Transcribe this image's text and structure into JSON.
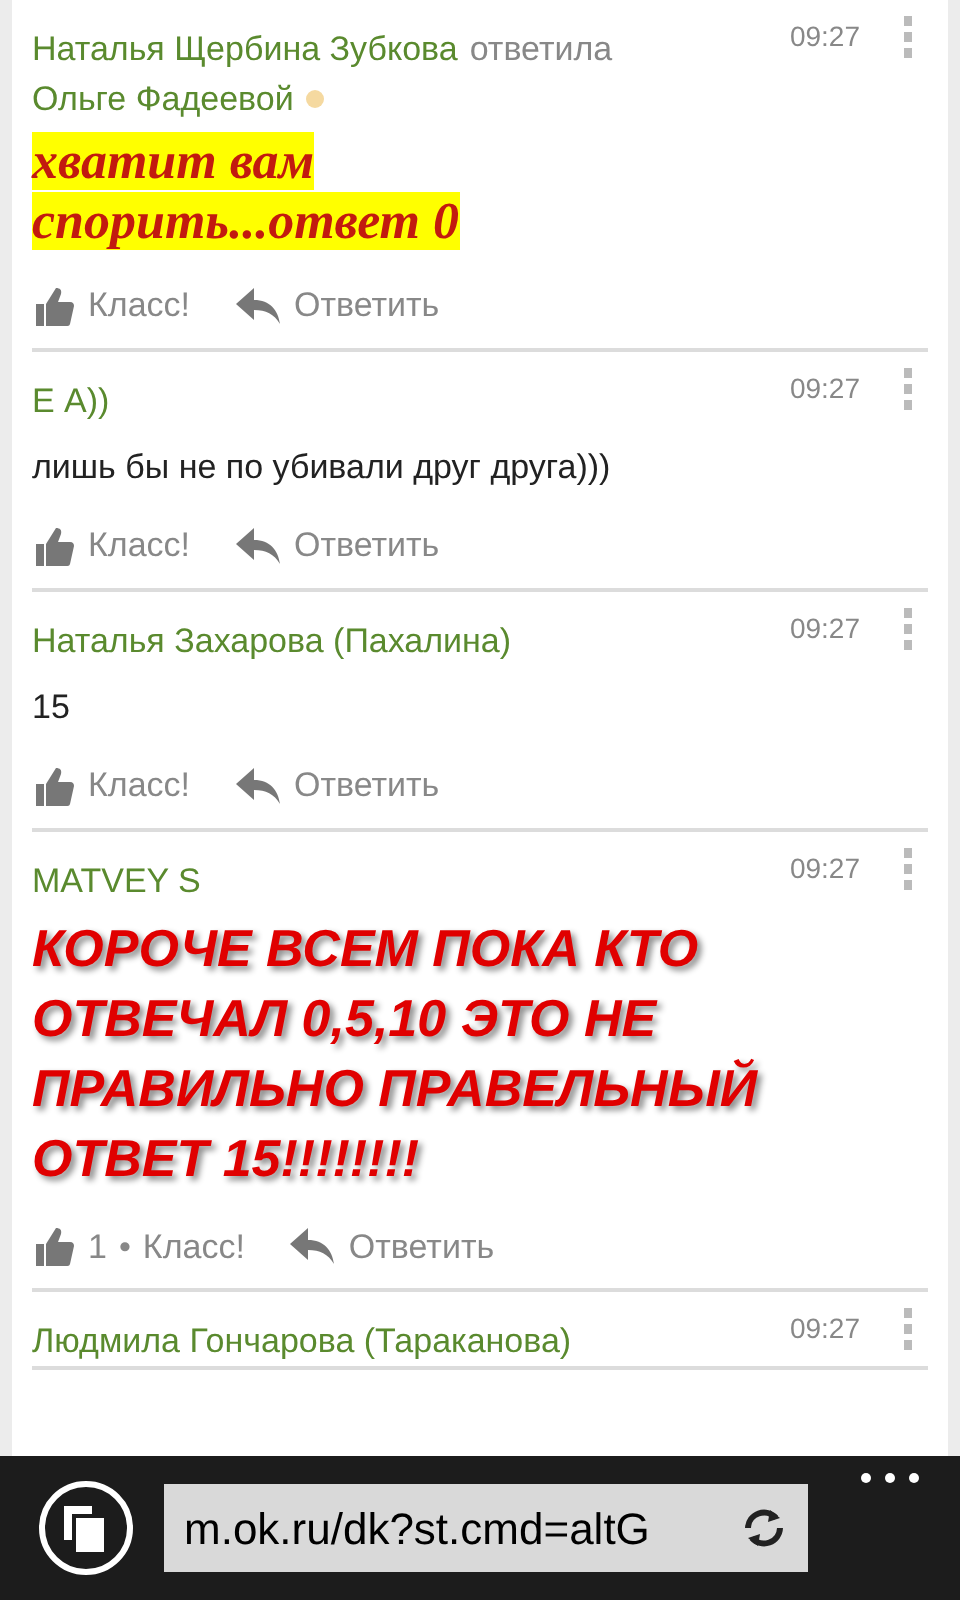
{
  "comments": [
    {
      "author": "Наталья Щербина Зубкова",
      "reply_verb": "ответила",
      "reply_to": "Ольге Фадеевой",
      "online": true,
      "time": "09:27",
      "kind": "highlight",
      "text": "хватит вам спорить...ответ 0",
      "like_label": "Класс!",
      "reply_label": "Ответить"
    },
    {
      "author": "Е А))",
      "online": false,
      "time": "09:27",
      "kind": "plain",
      "text": "лишь бы не по убивали друг друга)))",
      "like_label": "Класс!",
      "reply_label": "Ответить"
    },
    {
      "author": "Наталья Захарова (Пахалина)",
      "online": false,
      "time": "09:27",
      "kind": "plain",
      "text": "15",
      "like_label": "Класс!",
      "reply_label": "Ответить"
    },
    {
      "author": "MATVEY S",
      "online": false,
      "time": "09:27",
      "kind": "shout",
      "text": "КОРОЧЕ ВСЕМ ПОКА КТО ОТВЕЧАЛ 0,5,10 ЭТО НЕ ПРАВИЛЬНО ПРАВЕЛЬНЫЙ ОТВЕТ 15!!!!!!!!",
      "like_count": "1",
      "like_separator": "•",
      "like_label": "Класс!",
      "reply_label": "Ответить"
    },
    {
      "author": "Людмила Гончарова (Тараканова)",
      "online": false,
      "time": "09:27",
      "kind": "cut"
    }
  ],
  "address_bar": {
    "url": "m.ok.ru/dk?st.cmd=altG"
  }
}
